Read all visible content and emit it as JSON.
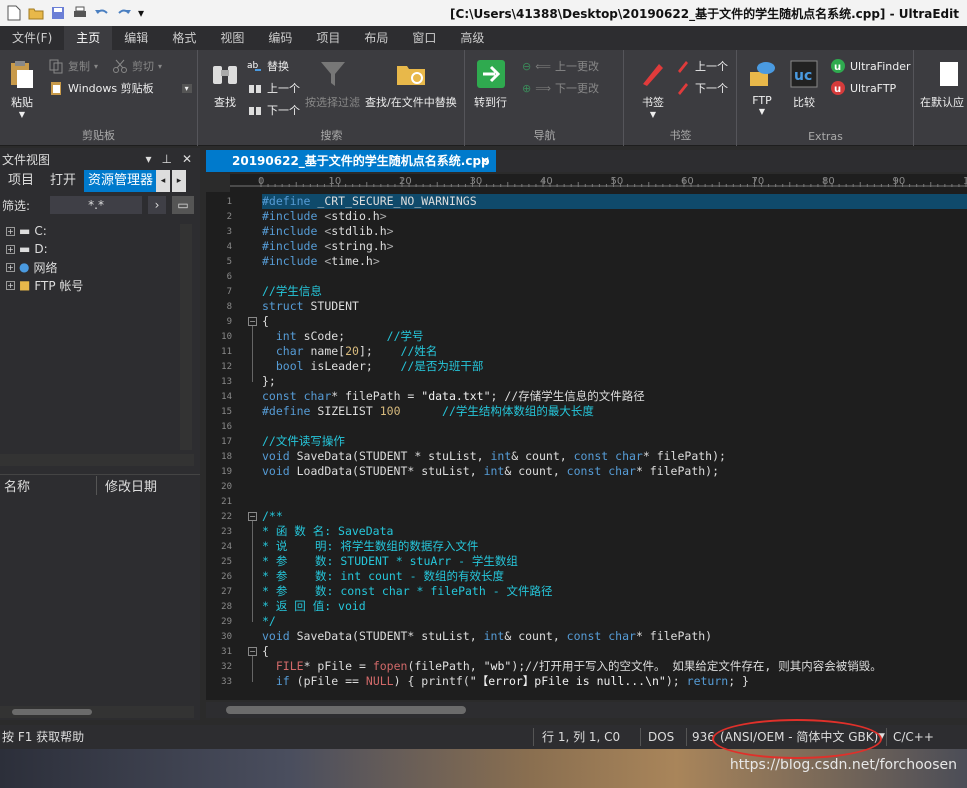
{
  "window": {
    "title": "[C:\\Users\\41388\\Desktop\\20190622_基于文件的学生随机点名系统.cpp] - UltraEdit"
  },
  "menu": {
    "tabs": [
      "文件(F)",
      "主页",
      "编辑",
      "格式",
      "视图",
      "编码",
      "项目",
      "布局",
      "窗口",
      "高级"
    ],
    "active": "主页"
  },
  "ribbon": {
    "clipboard": {
      "paste": "粘贴",
      "copy": "复制",
      "cut": "剪切",
      "clip_select": "Windows 剪贴板",
      "label": "剪贴板"
    },
    "search": {
      "find": "查找",
      "replace": "替换",
      "prev": "上一个",
      "next": "下一个",
      "filter": "按选择过滤",
      "find_in_files": "查找/在文件中替换",
      "label": "搜索"
    },
    "nav": {
      "goto": "转到行",
      "prev_change": "上一更改",
      "next_change": "下一更改",
      "label": "导航"
    },
    "bookmarks": {
      "bookmark": "书签",
      "prev": "上一个",
      "next": "下一个",
      "label": "书签"
    },
    "extras": {
      "ftp": "FTP",
      "compare": "比较",
      "finder": "UltraFinder",
      "uftp": "UltraFTP",
      "label": "Extras",
      "default_app": "在默认应"
    }
  },
  "left_panel": {
    "title": "文件视图",
    "tabs": [
      "项目",
      "打开",
      "资源管理器"
    ],
    "active_tab": "资源管理器",
    "filter_label": "筛选:",
    "filter_value": "*.*",
    "tree": [
      "C:",
      "D:",
      "网络",
      "FTP 帐号"
    ],
    "columns": [
      "名称",
      "修改日期"
    ]
  },
  "editor": {
    "tab_label": "20190622_基于文件的学生随机点名系统.cpp",
    "ruler_ticks": [
      "0",
      "10",
      "20",
      "30",
      "40",
      "50",
      "60",
      "70",
      "80",
      "90",
      "10"
    ],
    "lines": [
      "#define _CRT_SECURE_NO_WARNINGS",
      "#include <stdio.h>",
      "#include <stdlib.h>",
      "#include <string.h>",
      "#include <time.h>",
      "",
      "//学生信息",
      "struct STUDENT",
      "{",
      "  int sCode;      //学号",
      "  char name[20];    //姓名",
      "  bool isLeader;    //是否为班干部",
      "};",
      "const char* filePath = \"data.txt\"; //存储学生信息的文件路径",
      "#define SIZELIST 100      //学生结构体数组的最大长度",
      "",
      "//文件读写操作",
      "void SaveData(STUDENT * stuList, int& count, const char* filePath);",
      "void LoadData(STUDENT* stuList, int& count, const char* filePath);",
      "",
      "",
      "/**",
      "* 函 数 名: SaveData",
      "* 说    明: 将学生数组的数据存入文件",
      "* 参    数: STUDENT * stuArr - 学生数组",
      "* 参    数: int count - 数组的有效长度",
      "* 参    数: const char * filePath - 文件路径",
      "* 返 回 值: void",
      "*/",
      "void SaveData(STUDENT* stuList, int& count, const char* filePath)",
      "{",
      "  FILE* pFile = fopen(filePath, \"wb\");//打开用于写入的空文件。 如果给定文件存在, 则其内容会被销毁。",
      "  if (pFile == NULL) { printf(\"【error】pFile is null...\\n\"); return; }"
    ]
  },
  "status": {
    "help": "按 F1 获取帮助",
    "position": "行 1, 列 1, C0",
    "lineend": "DOS",
    "codepage_num": "936",
    "encoding": "(ANSI/OEM - 简体中文 GBK)",
    "language": "C/C++"
  },
  "watermark": "https://blog.csdn.net/forchoosen",
  "colors": {
    "accent": "#007acc",
    "annotation": "#e0302a"
  }
}
